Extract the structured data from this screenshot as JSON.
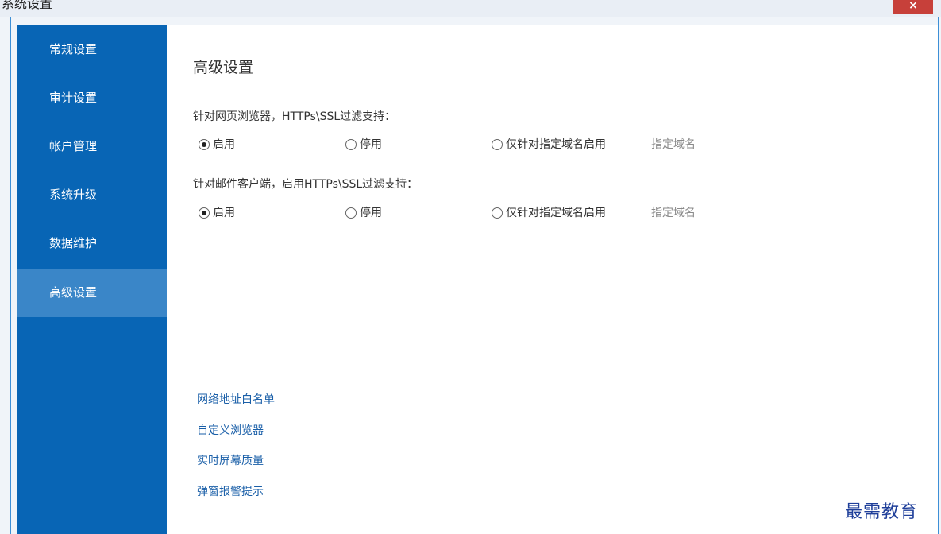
{
  "window": {
    "title": "系统设置",
    "close_label": "×"
  },
  "sidebar": {
    "items": [
      {
        "label": "常规设置"
      },
      {
        "label": "审计设置"
      },
      {
        "label": "帐户管理"
      },
      {
        "label": "系统升级"
      },
      {
        "label": "数据维护"
      },
      {
        "label": "高级设置",
        "active": true
      }
    ]
  },
  "main": {
    "title": "高级设置",
    "groups": [
      {
        "label": "针对网页浏览器，HTTPs\\SSL过滤支持：",
        "options": [
          "启用",
          "停用",
          "仅针对指定域名启用"
        ],
        "selected": "启用",
        "domain_link": "指定域名"
      },
      {
        "label": "针对邮件客户端，启用HTTPs\\SSL过滤支持：",
        "options": [
          "启用",
          "停用",
          "仅针对指定域名启用"
        ],
        "selected": "启用",
        "domain_link": "指定域名"
      }
    ],
    "links": [
      "网络地址白名单",
      "自定义浏览器",
      "实时屏幕质量",
      "弹窗报警提示"
    ]
  },
  "watermark": "最需教育",
  "colors": {
    "sidebar_bg": "#0865b5",
    "sidebar_active": "#3a86c8",
    "link": "#1a5fa8",
    "close_button": "#c7403a"
  }
}
